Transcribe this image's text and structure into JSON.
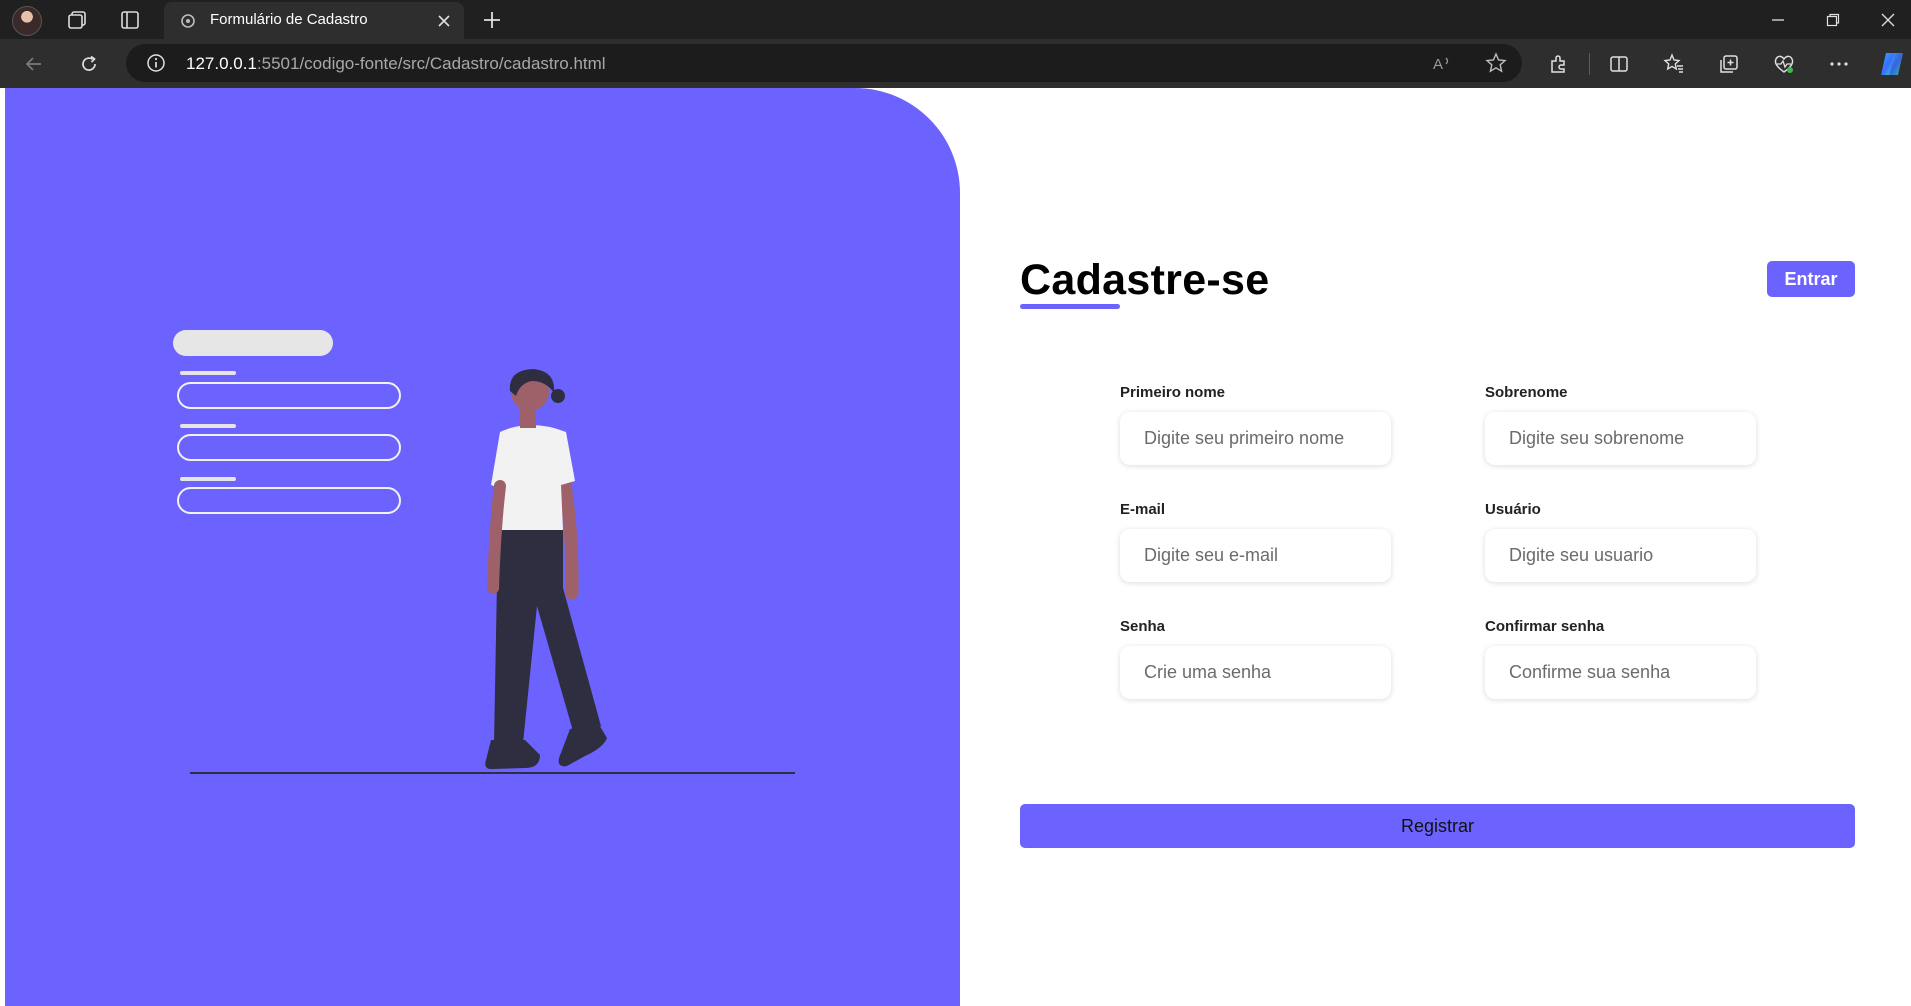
{
  "browser": {
    "tab_title": "Formulário de Cadastro",
    "url_host": "127.0.0.1",
    "url_path": ":5501/codigo-fonte/src/Cadastro/cadastro.html"
  },
  "form": {
    "title": "Cadastre-se",
    "login_label": "Entrar",
    "register_label": "Registrar",
    "fields": [
      {
        "label": "Primeiro nome",
        "placeholder": "Digite seu primeiro nome"
      },
      {
        "label": "Sobrenome",
        "placeholder": "Digite seu sobrenome"
      },
      {
        "label": "E-mail",
        "placeholder": "Digite seu e-mail"
      },
      {
        "label": "Usuário",
        "placeholder": "Digite seu usuario"
      },
      {
        "label": "Senha",
        "placeholder": "Crie uma senha"
      },
      {
        "label": "Confirmar senha",
        "placeholder": "Confirme sua senha"
      }
    ]
  },
  "colors": {
    "accent": "#6c63ff",
    "chrome_dark": "#202020",
    "chrome_toolbar": "#2e2e2e"
  },
  "icons": [
    "avatar",
    "collections-icon",
    "tab-actions-icon",
    "tab-favicon",
    "close-tab-icon",
    "new-tab-icon",
    "minimize-icon",
    "restore-icon",
    "close-window-icon",
    "back-icon",
    "refresh-icon",
    "info-icon",
    "read-aloud-icon",
    "favorite-star-icon",
    "extensions-icon",
    "split-screen-icon",
    "favorites-icon",
    "collections-toolbar-icon",
    "performance-icon",
    "more-icon",
    "copilot-icon"
  ]
}
